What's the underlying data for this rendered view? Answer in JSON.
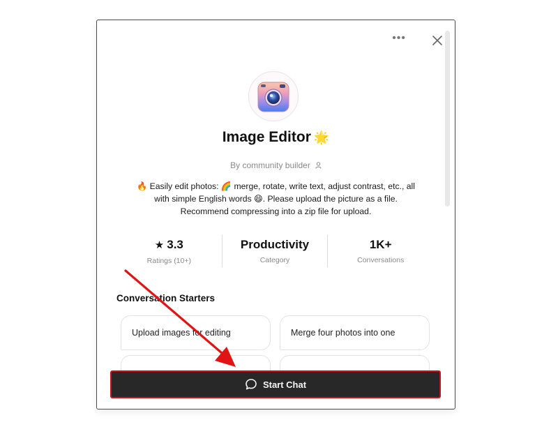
{
  "header": {
    "more_icon": "more-horizontal-icon",
    "close_icon": "close-icon"
  },
  "gpt": {
    "avatar_icon": "camera-icon",
    "title": "Image Editor",
    "title_emoji": "🌟",
    "byline": "By community builder",
    "byline_icon": "person-icon",
    "description_line1": "🔥 Easily edit photos: 🌈 merge, rotate, write text, adjust contrast, etc., all",
    "description_line2": "with simple English words 😄. Please upload the picture as a file.",
    "description_line3": "Recommend compressing into a zip file for upload."
  },
  "stats": [
    {
      "value": "3.3",
      "icon": "star-icon",
      "label": "Ratings (10+)"
    },
    {
      "value": "Productivity",
      "label": "Category"
    },
    {
      "value": "1K+",
      "label": "Conversations"
    }
  ],
  "starters": {
    "title": "Conversation Starters",
    "items": [
      "Upload images for editing",
      "Merge four photos into one",
      "",
      ""
    ]
  },
  "start_chat": {
    "label": "Start Chat",
    "icon": "chat-bubble-icon"
  },
  "annotation": {
    "arrow_color": "#e01414",
    "highlight_color": "#c8141a"
  }
}
